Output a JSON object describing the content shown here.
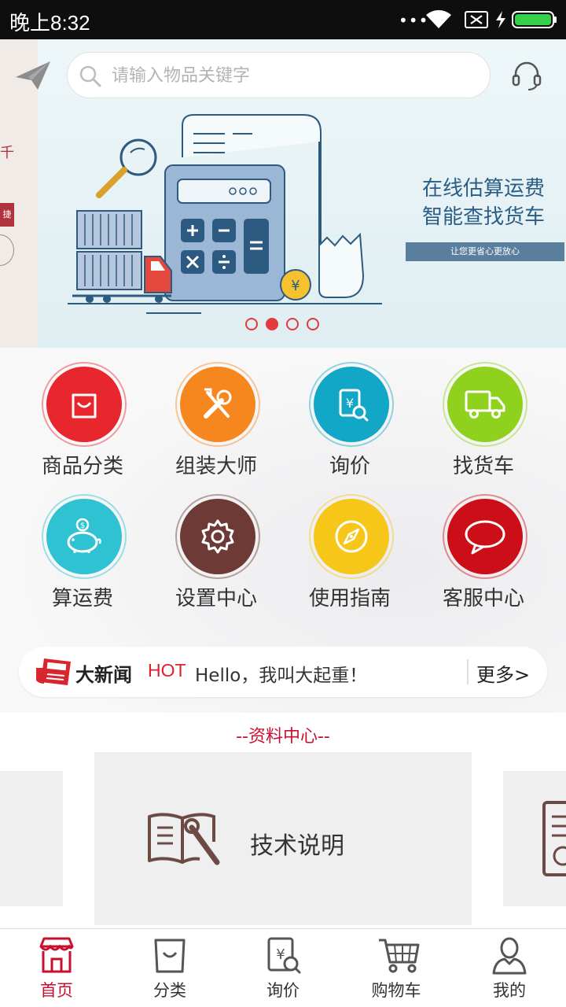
{
  "status_bar": {
    "time": "晚上8:32",
    "dots": "•••"
  },
  "search": {
    "placeholder": "请输入物品关键字"
  },
  "banner": {
    "title_line1": "在线估算运费",
    "title_line2": "智能查找货车",
    "tagline": "让您更省心更放心",
    "left_strip_text": "捷",
    "left_strip_char": "千",
    "active_slide": 2,
    "slide_count": 4
  },
  "grid": {
    "items": [
      {
        "label": "商品分类",
        "icon": "shopping-bag-icon",
        "color": "#e8262e"
      },
      {
        "label": "组装大师",
        "icon": "tools-icon",
        "color": "#f6871e"
      },
      {
        "label": "询价",
        "icon": "price-inquiry-icon",
        "color": "#12a7c6"
      },
      {
        "label": "找货车",
        "icon": "truck-icon",
        "color": "#8fd11d"
      },
      {
        "label": "算运费",
        "icon": "piggy-bank-icon",
        "color": "#2fc2d2"
      },
      {
        "label": "设置中心",
        "icon": "gear-icon",
        "color": "#6e3a35"
      },
      {
        "label": "使用指南",
        "icon": "compass-icon",
        "color": "#f6c618"
      },
      {
        "label": "客服中心",
        "icon": "chat-bubble-icon",
        "color": "#cc0e18"
      }
    ]
  },
  "news": {
    "title": "大新闻",
    "hot": "HOT",
    "text": "Hello，我叫大起重！",
    "more": "更多>"
  },
  "resource": {
    "title": "--资料中心--",
    "card_label": "技术说明"
  },
  "bottom_nav": {
    "items": [
      {
        "label": "首页",
        "icon": "home-store-icon",
        "active": true
      },
      {
        "label": "分类",
        "icon": "bag-icon",
        "active": false
      },
      {
        "label": "询价",
        "icon": "price-inquiry-icon",
        "active": false
      },
      {
        "label": "购物车",
        "icon": "cart-icon",
        "active": false
      },
      {
        "label": "我的",
        "icon": "user-icon",
        "active": false
      }
    ]
  },
  "colors": {
    "accent": "#c8102e",
    "news_hot": "#e0202a",
    "banner_text": "#2a5e86",
    "dot": "#e23a3f"
  }
}
